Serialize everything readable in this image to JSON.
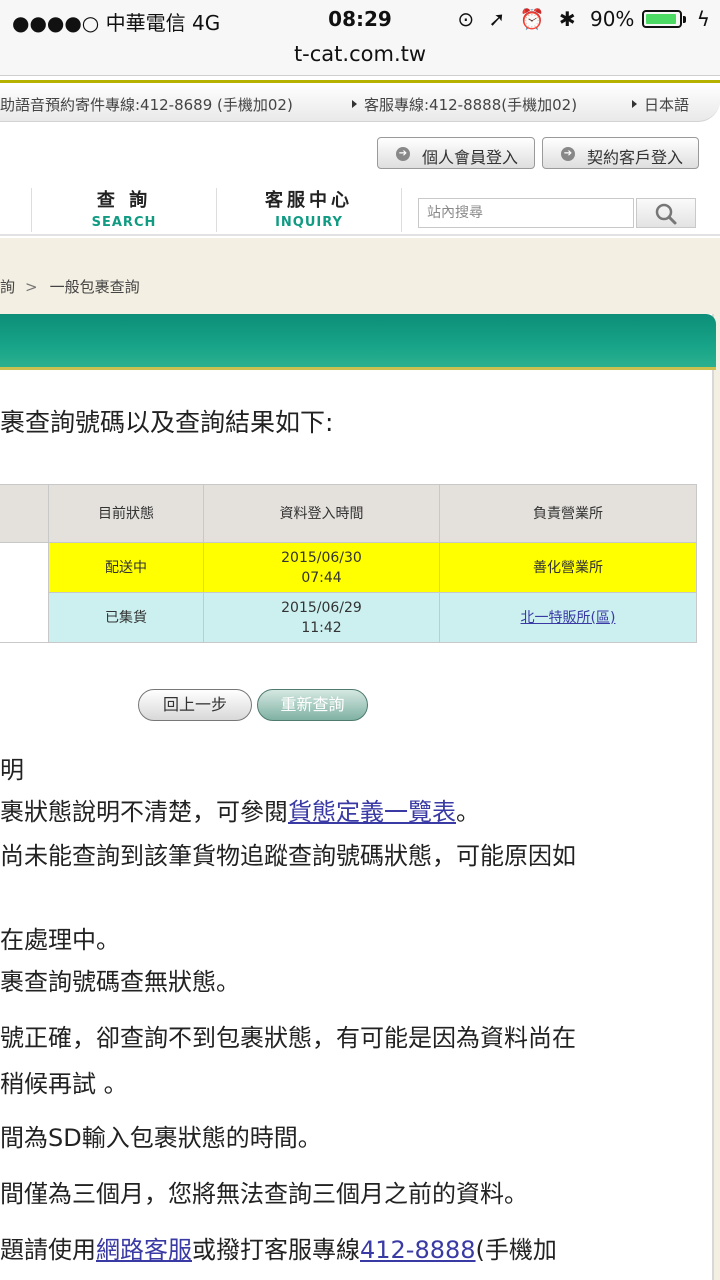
{
  "status_bar": {
    "carrier": "●●●●○ 中華電信  4G",
    "time": "08:29",
    "icons": [
      "rotation-lock-icon",
      "location-icon",
      "alarm-icon",
      "bluetooth-icon"
    ],
    "battery": "90%"
  },
  "url": "t-cat.com.tw",
  "top_links": {
    "booking": "助語音預約寄件專線:412-8689 (手機加02)",
    "service": "客服專線:412-8888(手機加02)",
    "language": "日本語"
  },
  "login": {
    "personal": "個人會員登入",
    "business": "契約客戶登入"
  },
  "nav": [
    {
      "zh": "查 詢",
      "en": "SEARCH"
    },
    {
      "zh": "客服中心",
      "en": "INQUIRY"
    }
  ],
  "search": {
    "placeholder": "站內搜尋"
  },
  "breadcrumb": {
    "parent": "詢",
    "current": "一般包裹查詢"
  },
  "heading": "裹查詢號碼以及查詢結果如下:",
  "table": {
    "headers": [
      "目前狀態",
      "資料登入時間",
      "負責營業所"
    ],
    "rows": [
      {
        "status": "配送中",
        "date": "2015/06/30",
        "time": "07:44",
        "office": "善化營業所"
      },
      {
        "status": "已集貨",
        "date": "2015/06/29",
        "time": "11:42",
        "office": "北一特販所(區)"
      }
    ]
  },
  "buttons": {
    "back": "回上一步",
    "retry": "重新查詢"
  },
  "notes": {
    "title": "明",
    "n1_pre": "裹狀態說明不清楚，可參閱",
    "n1_link": "貨態定義一覽表",
    "n1_post": "。",
    "n2": "尚未能查詢到該筆貨物追蹤查詢號碼狀態，可能原因如",
    "n3": "在處理中。",
    "n4": "裹查詢號碼查無狀態。",
    "n5": "號正確，卻查詢不到包裹狀態，有可能是因為資料尚在",
    "n6": "稍候再試 。",
    "n7": "間為SD輸入包裹狀態的時間。",
    "n8": "間僅為三個月，您將無法查詢三個月之前的資料。",
    "n9_pre": "題請使用",
    "n9_link1": "網路客服",
    "n9_mid": "或撥打客服專線",
    "n9_link2": "412-8888",
    "n9_post": "(手機加"
  },
  "colors": {
    "accent_green": "#17a488",
    "highlight_yellow": "#ffff00",
    "row_cyan": "#ccf0f0",
    "link": "#3a3aa5"
  }
}
